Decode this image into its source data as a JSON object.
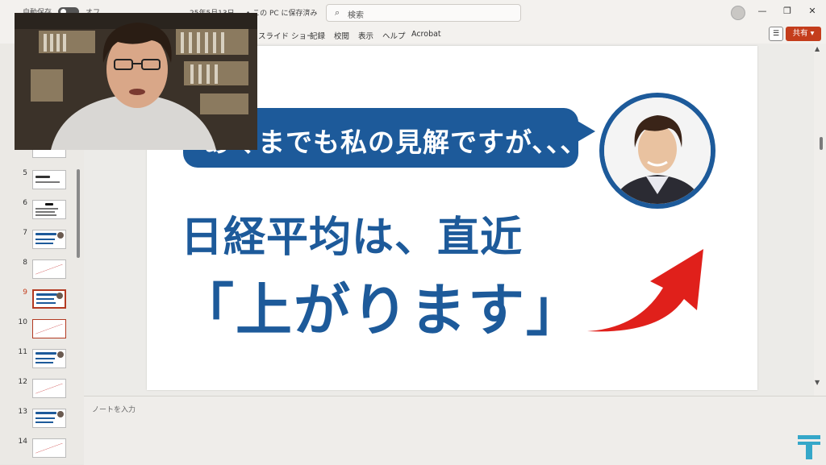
{
  "titlebar": {
    "autosave_label": "自動保存",
    "autosave_state": "オフ",
    "doc_status": "25年5月13日 ... • この PC に保存済み",
    "search_placeholder": "検索"
  },
  "ribbon": {
    "tabs": [
      "スライド ショー",
      "記録",
      "校閲",
      "表示",
      "ヘルプ",
      "Acrobat"
    ],
    "share_label": "共有"
  },
  "thumbnails": [
    {
      "num": "5",
      "variant": "qa",
      "label": "Q&Aコーナー"
    },
    {
      "num": "6",
      "variant": "text"
    },
    {
      "num": "7",
      "variant": "blue"
    },
    {
      "num": "8",
      "variant": "chart"
    },
    {
      "num": "9",
      "variant": "blue",
      "selected": true
    },
    {
      "num": "10",
      "variant": "chart",
      "current": true
    },
    {
      "num": "11",
      "variant": "blue"
    },
    {
      "num": "12",
      "variant": "chart"
    },
    {
      "num": "13",
      "variant": "blue"
    },
    {
      "num": "14",
      "variant": "chart"
    }
  ],
  "slide": {
    "bubble_text": "あくまでも私の見解ですが、、、",
    "headline_1": "日経平均は、直近",
    "headline_2": "「上がります」"
  },
  "notes": {
    "placeholder": "ノートを入力"
  },
  "colors": {
    "slide_blue": "#1d5a9a",
    "arrow_red": "#e0201b",
    "share_button": "#c43d1c",
    "logo_teal": "#35a7c9"
  },
  "icons": {
    "search": "search-icon",
    "account": "account-icon",
    "minimize": "minimize-icon",
    "restore": "restore-icon",
    "close": "close-icon",
    "comment": "comment-icon",
    "logo": "t-logo-icon"
  }
}
